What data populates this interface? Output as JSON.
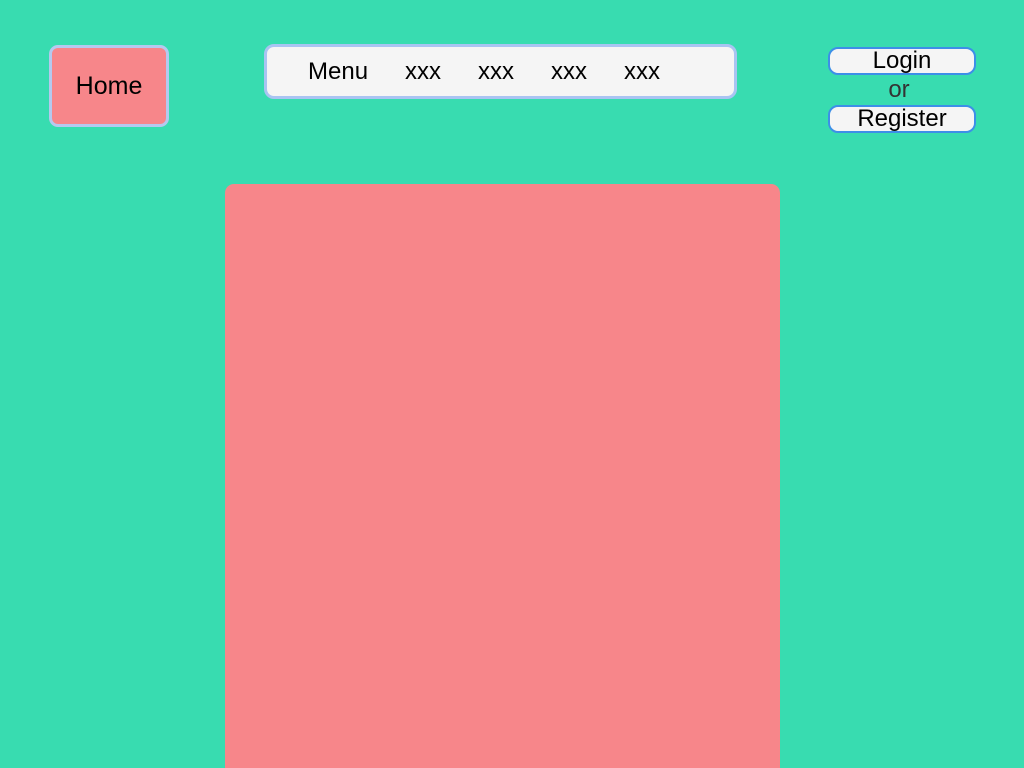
{
  "header": {
    "home_label": "Home",
    "menu": {
      "label": "Menu",
      "items": [
        "xxx",
        "xxx",
        "xxx",
        "xxx"
      ]
    },
    "auth": {
      "login_label": "Login",
      "or_label": "or",
      "register_label": "Register"
    }
  },
  "colors": {
    "background": "#38dcb0",
    "home_button": "#f7868a",
    "content_panel": "#f7868a",
    "menu_bar": "#f5f5f5",
    "menu_border": "#a9c4f2",
    "auth_border": "#3d8fe8"
  }
}
